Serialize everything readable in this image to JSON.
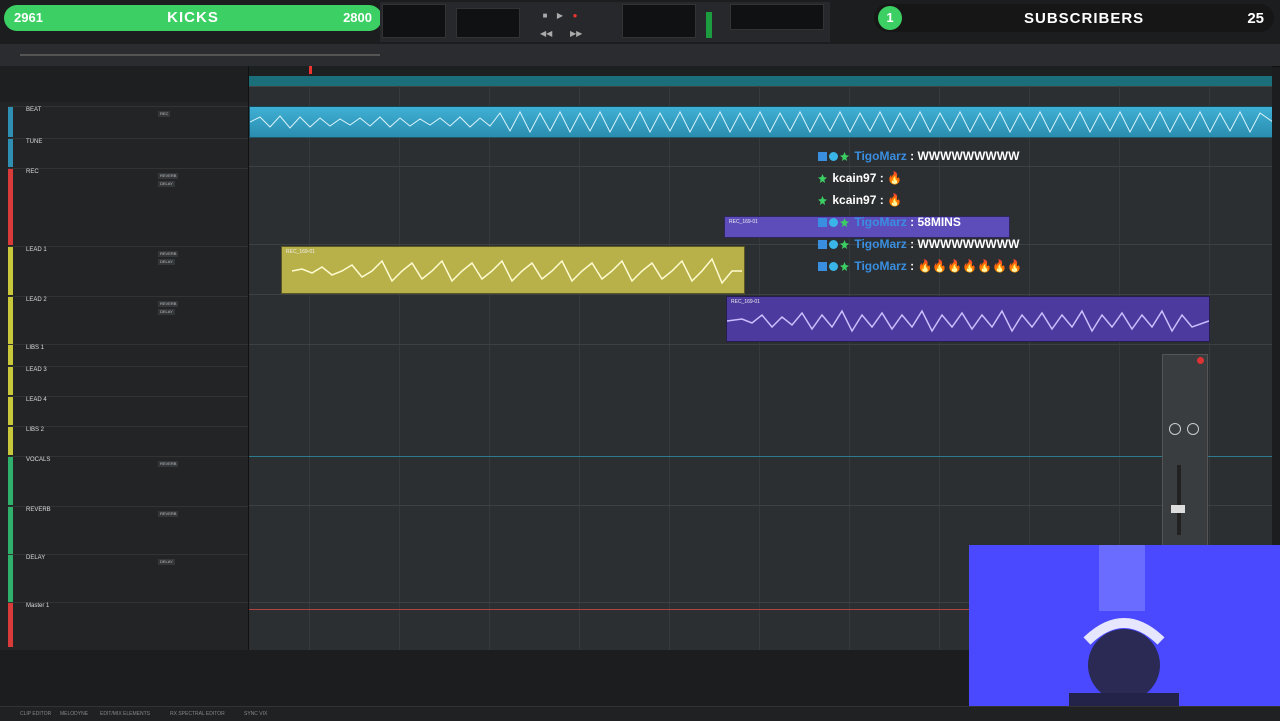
{
  "overlay": {
    "left_pill": {
      "left_num": "2961",
      "title": "KICKS",
      "right_num": "2800",
      "progress": 0.93
    },
    "subscribers": {
      "badge": "1",
      "title": "SUBSCRIBERS",
      "count": "25"
    }
  },
  "colors": {
    "pill_green": "#3ccf63",
    "beat_clip": "#2a8db0",
    "lead_clip": "#b8b14a",
    "vocal_clip": "#4c3a9e",
    "webcam_bg": "#4a49ff"
  },
  "tracks": [
    {
      "name": "BEAT",
      "color": "#2e8fb3"
    },
    {
      "name": "TUNE",
      "color": "#2e8fb3"
    },
    {
      "name": "REC",
      "color": "#d93a3a"
    },
    {
      "name": "LEAD 1",
      "color": "#c8c83a"
    },
    {
      "name": "LEAD 2",
      "color": "#c8c83a"
    },
    {
      "name": "LIBS 1",
      "color": "#c8c83a"
    },
    {
      "name": "LEAD 3",
      "color": "#c8c83a"
    },
    {
      "name": "LEAD 4",
      "color": "#c8c83a"
    },
    {
      "name": "LIBS 2",
      "color": "#c8c83a"
    },
    {
      "name": "VOCALS",
      "color": "#2fb06b"
    },
    {
      "name": "REVERB",
      "color": "#2fb06b"
    },
    {
      "name": "DELAY",
      "color": "#2fb06b"
    },
    {
      "name": "Master 1",
      "color": "#d93a3a"
    }
  ],
  "clips": {
    "rec_label": "REC_169-01",
    "lead_label": "REC_169-01",
    "vocal_label": "REC_169-01"
  },
  "chat": [
    {
      "user": "TigoMarz",
      "message": "WWWWWWWWW"
    },
    {
      "user": "kcain97",
      "message": "🔥"
    },
    {
      "user": "kcain97",
      "message": "🔥"
    },
    {
      "user": "TigoMarz",
      "message": "58MINS"
    },
    {
      "user": "TigoMarz",
      "message": "WWWWWWWWW"
    },
    {
      "user": "TigoMarz",
      "message": "🔥🔥🔥🔥🔥🔥🔥"
    }
  ],
  "bottom_tabs": [
    "CLIP EDITOR",
    "MELODYNE",
    "EDIT/MIX ELEMENTS",
    "RX SPECTRAL EDITOR",
    "SYNC VIX"
  ]
}
